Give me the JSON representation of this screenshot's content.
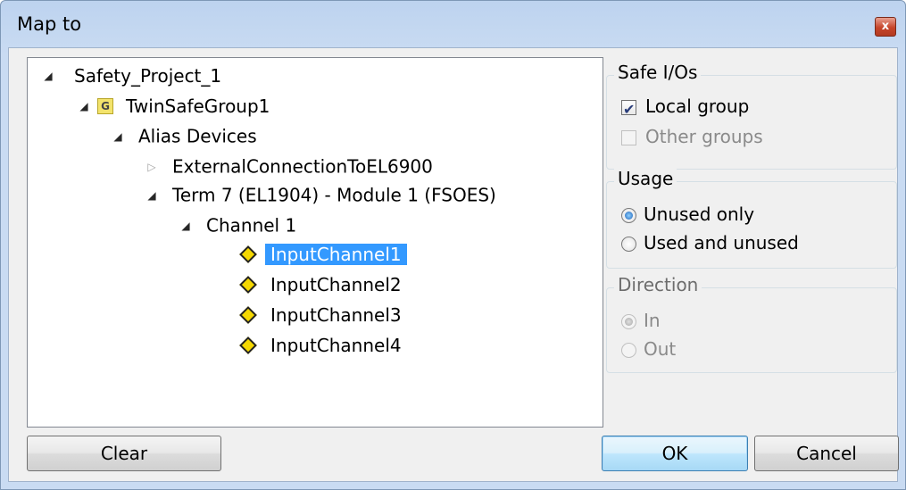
{
  "window": {
    "title": "Map to",
    "close_glyph": "x"
  },
  "tree": {
    "root": "Safety_Project_1",
    "group": "TwinSafeGroup1",
    "group_icon_letter": "G",
    "alias_devices": "Alias Devices",
    "external": "ExternalConnectionToEL6900",
    "term": "Term 7 (EL1904) - Module 1 (FSOES)",
    "channel": "Channel 1",
    "inputs": [
      "InputChannel1",
      "InputChannel2",
      "InputChannel3",
      "InputChannel4"
    ],
    "selected": "InputChannel1",
    "icons": {
      "expanded": "triangle-down-icon",
      "collapsed": "triangle-right-icon",
      "group": "g-group-icon",
      "channel": "yellow-diamond-icon"
    }
  },
  "safe_ios": {
    "legend": "Safe I/Os",
    "local_group": {
      "label": "Local group",
      "checked": true,
      "enabled": true
    },
    "other_groups": {
      "label": "Other groups",
      "checked": false,
      "enabled": false
    }
  },
  "usage": {
    "legend": "Usage",
    "unused_only": {
      "label": "Unused only",
      "selected": true
    },
    "used_and_unused": {
      "label": "Used and unused",
      "selected": false
    }
  },
  "direction": {
    "legend": "Direction",
    "in": {
      "label": "In",
      "selected": true,
      "enabled": false
    },
    "out": {
      "label": "Out",
      "selected": false,
      "enabled": false
    }
  },
  "buttons": {
    "clear": "Clear",
    "ok": "OK",
    "cancel": "Cancel"
  },
  "colors": {
    "selection": "#3399ff",
    "frame": "#c9dbf2",
    "client": "#f0f0f0"
  }
}
